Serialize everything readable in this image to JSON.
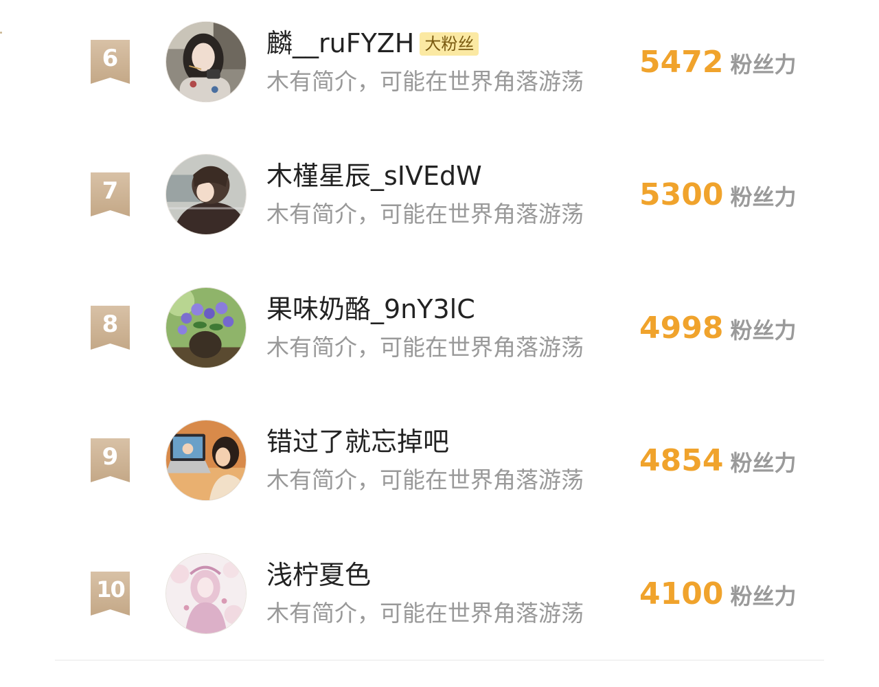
{
  "ranking": {
    "score_unit": "粉丝力",
    "entries": [
      {
        "rank": "6",
        "name": "麟__ruFYZH",
        "tag": "大粉丝",
        "bio": "木有简介，可能在世界角落游荡",
        "score": "5472",
        "avatar_icon": "girl-eating-noodles-avatar"
      },
      {
        "rank": "7",
        "name": "木槿星辰_sIVEdW",
        "tag": "",
        "bio": "木有简介，可能在世界角落游荡",
        "score": "5300",
        "avatar_icon": "anime-boy-avatar"
      },
      {
        "rank": "8",
        "name": "果味奶酪_9nY3lC",
        "tag": "",
        "bio": "木有简介，可能在世界角落游荡",
        "score": "4998",
        "avatar_icon": "violet-flowers-avatar"
      },
      {
        "rank": "9",
        "name": "错过了就忘掉吧",
        "tag": "",
        "bio": "木有简介，可能在世界角落游荡",
        "score": "4854",
        "avatar_icon": "girl-with-laptop-avatar"
      },
      {
        "rank": "10",
        "name": "浅柠夏色",
        "tag": "",
        "bio": "木有简介，可能在世界角落游荡",
        "score": "4100",
        "avatar_icon": "pink-anime-girl-avatar"
      }
    ]
  },
  "colors": {
    "badge": "#c9ad8d",
    "score": "#f0a32c",
    "tag_bg": "#fbe9a3",
    "bio": "#999999"
  }
}
